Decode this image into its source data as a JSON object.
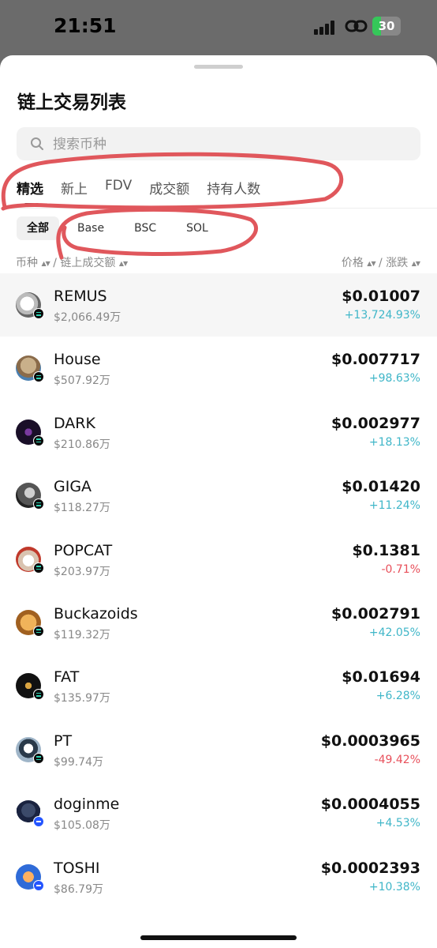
{
  "status_bar": {
    "time": "21:51",
    "battery": "30"
  },
  "sheet": {
    "title": "链上交易列表",
    "search_placeholder": "搜索币种"
  },
  "tabs": [
    {
      "label": "精选",
      "active": true
    },
    {
      "label": "新上",
      "active": false
    },
    {
      "label": "FDV",
      "active": false
    },
    {
      "label": "成交额",
      "active": false
    },
    {
      "label": "持有人数",
      "active": false
    }
  ],
  "chips": [
    {
      "label": "全部",
      "active": true
    },
    {
      "label": "Base",
      "active": false
    },
    {
      "label": "BSC",
      "active": false
    },
    {
      "label": "SOL",
      "active": false
    }
  ],
  "columns": {
    "left_a": "币种",
    "left_sep": " / ",
    "left_b": "链上成交额",
    "right_a": "价格",
    "right_sep": " / ",
    "right_b": "涨跌"
  },
  "colors": {
    "up": "#3fb6c8",
    "down": "#e8505b",
    "annotation": "#e0575c"
  },
  "tokens": [
    {
      "name": "REMUS",
      "volume": "$2,066.49万",
      "price": "$0.01007",
      "change": "+13,724.93%",
      "dir": "up",
      "chain": "sol"
    },
    {
      "name": "House",
      "volume": "$507.92万",
      "price": "$0.007717",
      "change": "+98.63%",
      "dir": "up",
      "chain": "sol"
    },
    {
      "name": "DARK",
      "volume": "$210.86万",
      "price": "$0.002977",
      "change": "+18.13%",
      "dir": "up",
      "chain": "sol"
    },
    {
      "name": "GIGA",
      "volume": "$118.27万",
      "price": "$0.01420",
      "change": "+11.24%",
      "dir": "up",
      "chain": "sol"
    },
    {
      "name": "POPCAT",
      "volume": "$203.97万",
      "price": "$0.1381",
      "change": "-0.71%",
      "dir": "down",
      "chain": "sol"
    },
    {
      "name": "Buckazoids",
      "volume": "$119.32万",
      "price": "$0.002791",
      "change": "+42.05%",
      "dir": "up",
      "chain": "sol"
    },
    {
      "name": "FAT",
      "volume": "$135.97万",
      "price": "$0.01694",
      "change": "+6.28%",
      "dir": "up",
      "chain": "sol"
    },
    {
      "name": "PT",
      "volume": "$99.74万",
      "price": "$0.0003965",
      "change": "-49.42%",
      "dir": "down",
      "chain": "sol"
    },
    {
      "name": "doginme",
      "volume": "$105.08万",
      "price": "$0.0004055",
      "change": "+4.53%",
      "dir": "up",
      "chain": "base"
    },
    {
      "name": "TOSHI",
      "volume": "$86.79万",
      "price": "$0.0002393",
      "change": "+10.38%",
      "dir": "up",
      "chain": "base"
    }
  ]
}
